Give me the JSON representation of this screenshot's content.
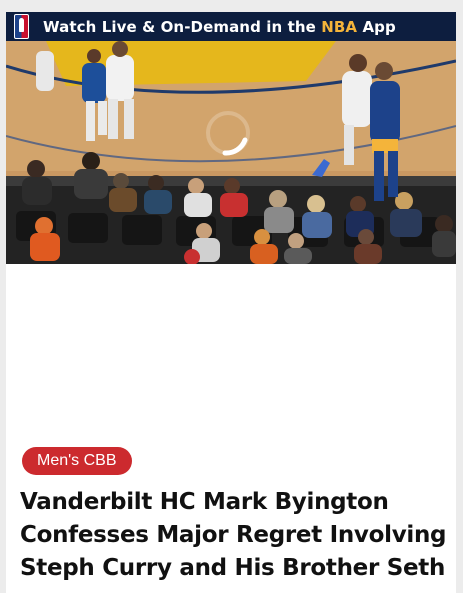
{
  "video": {
    "banner": {
      "text_prefix": "Watch Live & On-Demand in the ",
      "brand": "NBA",
      "text_suffix": " App",
      "logo_icon": "nba-logo-icon",
      "background_color": "#0d1e3f",
      "brand_color": "#f4b43a"
    },
    "loading_icon": "loading-spinner-icon"
  },
  "article": {
    "category": "Men's CBB",
    "category_color": "#cc2a2e",
    "headline": "Vanderbilt HC Mark Byington Confesses Major Regret Involving Steph Curry and His Brother Seth"
  }
}
